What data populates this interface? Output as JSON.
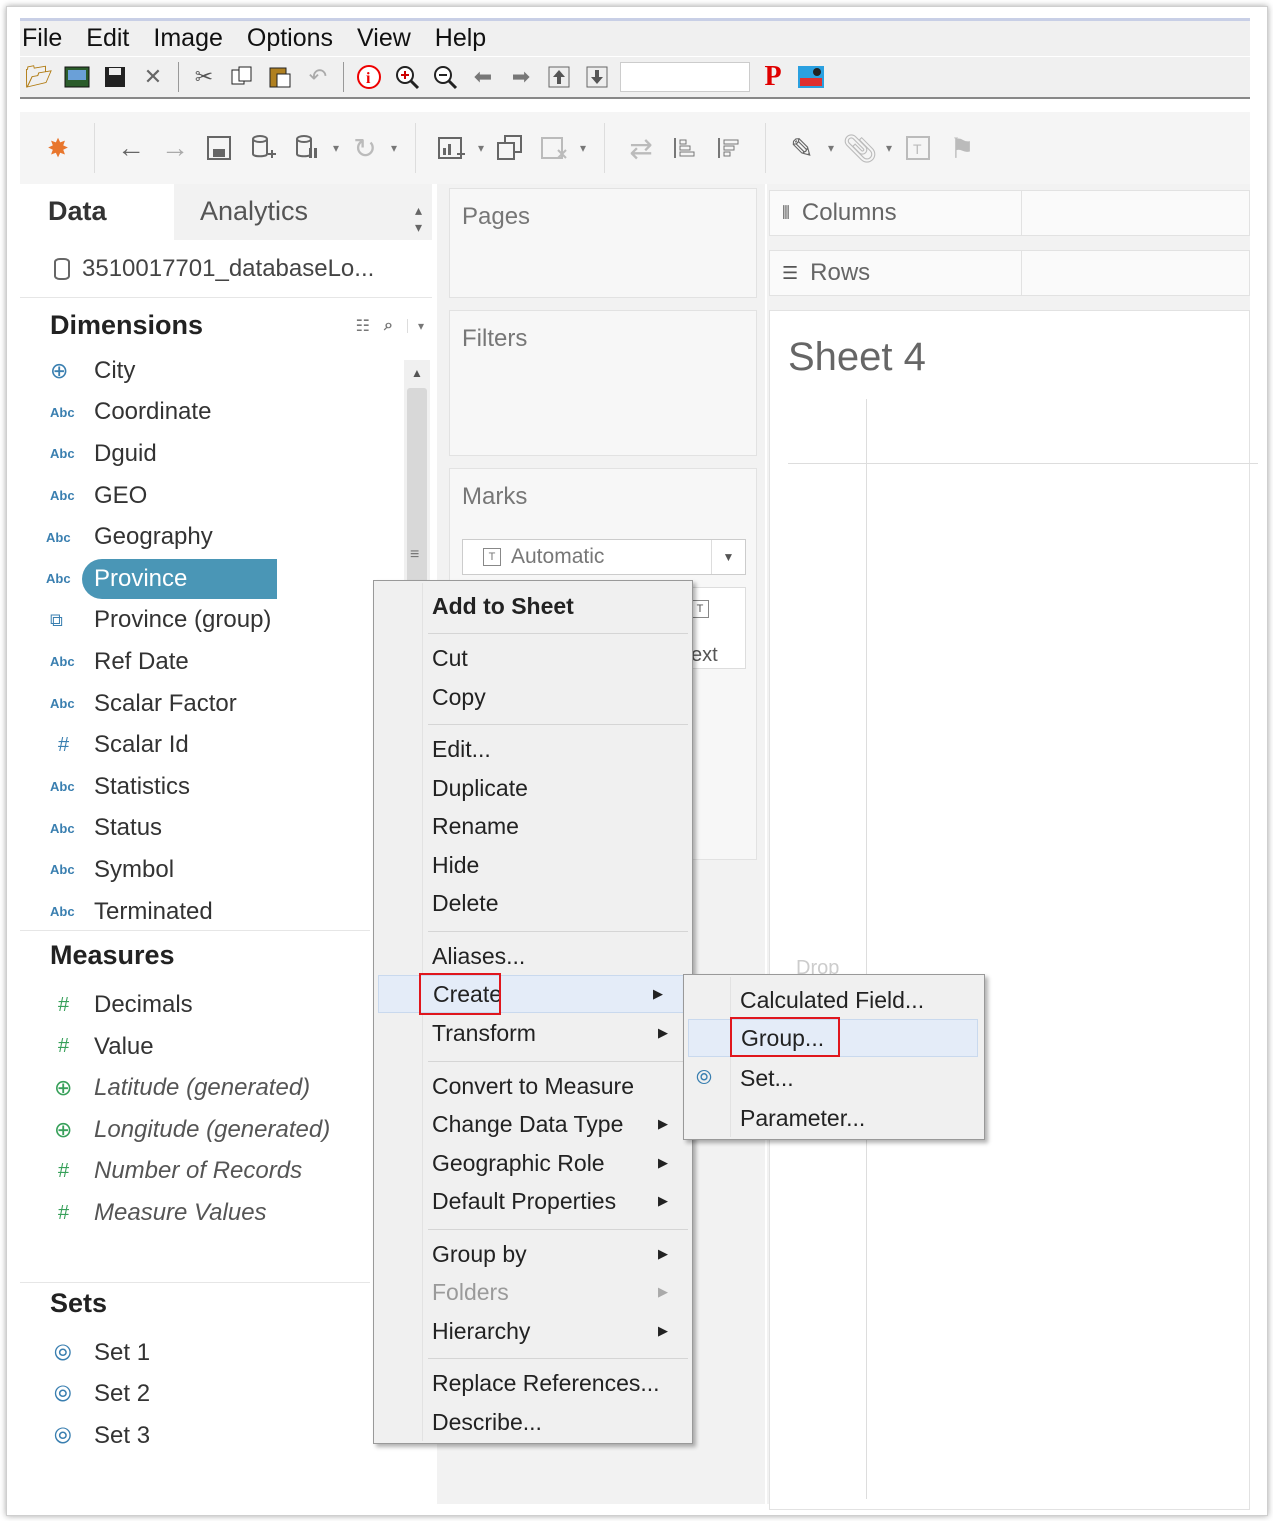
{
  "menubar": {
    "items": [
      "File",
      "Edit",
      "Image",
      "Options",
      "View",
      "Help"
    ]
  },
  "legacy_toolbar": {
    "icons": [
      "open-folder-icon",
      "image-icon",
      "save-disk-icon",
      "close-x-icon",
      "cut-icon",
      "copy-icon",
      "paste-icon",
      "undo-icon",
      "info-icon",
      "zoom-in-icon",
      "zoom-out-icon",
      "arrow-left-icon",
      "arrow-right-icon",
      "move-up-icon",
      "move-down-icon",
      "p-icon",
      "picture-icon"
    ],
    "p_label": "P"
  },
  "tableau_toolbar": {
    "icons": [
      "tableau-logo-icon",
      "back-icon",
      "forward-icon",
      "save-icon",
      "new-datasource-icon",
      "pause-updates-icon",
      "refresh-icon",
      "new-worksheet-icon",
      "duplicate-icon",
      "clear-sheet-icon",
      "swap-icon",
      "sort-asc-icon",
      "sort-desc-icon",
      "highlight-icon",
      "group-members-icon",
      "show-labels-icon",
      "pin-icon"
    ]
  },
  "left_pane": {
    "tab_data": "Data",
    "tab_analytics": "Analytics",
    "datasource": "3510017701_databaseLo...",
    "dimensions_title": "Dimensions",
    "dimensions": [
      {
        "type": "geo",
        "label": "City"
      },
      {
        "type": "abc",
        "label": "Coordinate"
      },
      {
        "type": "abc",
        "label": "Dguid"
      },
      {
        "type": "abc",
        "label": "GEO"
      },
      {
        "type": "abc-geo",
        "label": "Geography"
      },
      {
        "type": "abc-geo",
        "label": "Province"
      },
      {
        "type": "group",
        "label": "Province (group)"
      },
      {
        "type": "abc",
        "label": "Ref Date"
      },
      {
        "type": "abc",
        "label": "Scalar Factor"
      },
      {
        "type": "num",
        "label": "Scalar Id"
      },
      {
        "type": "abc",
        "label": "Statistics"
      },
      {
        "type": "abc",
        "label": "Status"
      },
      {
        "type": "abc",
        "label": "Symbol"
      },
      {
        "type": "abc",
        "label": "Terminated"
      }
    ],
    "measures_title": "Measures",
    "measures": [
      {
        "label": "Decimals"
      },
      {
        "label": "Value"
      },
      {
        "label": "Latitude (generated)"
      },
      {
        "label": "Longitude (generated)"
      },
      {
        "label": "Number of Records"
      },
      {
        "label": "Measure Values"
      }
    ],
    "sets_title": "Sets",
    "sets": [
      {
        "label": "Set 1"
      },
      {
        "label": "Set 2"
      },
      {
        "label": "Set 3"
      }
    ],
    "abc_icon_text": "Abc",
    "hash_icon_text": "#"
  },
  "shelves": {
    "pages": "Pages",
    "filters": "Filters",
    "marks": "Marks",
    "marks_type": "Automatic",
    "text_card": "ext",
    "columns": "Columns",
    "rows": "Rows"
  },
  "view": {
    "sheet_title": "Sheet 4",
    "drop_hint": "Drop"
  },
  "context_menu": {
    "items": [
      "Add to Sheet",
      "Cut",
      "Copy",
      "Edit...",
      "Duplicate",
      "Rename",
      "Hide",
      "Delete",
      "Aliases...",
      "Create",
      "Transform",
      "Convert to Measure",
      "Change Data Type",
      "Geographic Role",
      "Default Properties",
      "Group by",
      "Folders",
      "Hierarchy",
      "Replace References...",
      "Describe..."
    ],
    "submenu_items": [
      "Calculated Field...",
      "Group...",
      "Set...",
      "Parameter..."
    ]
  },
  "colors": {
    "selection": "#4a96b6",
    "highlight_box": "#e0161d",
    "menu_hover": "#e4ecf8"
  }
}
